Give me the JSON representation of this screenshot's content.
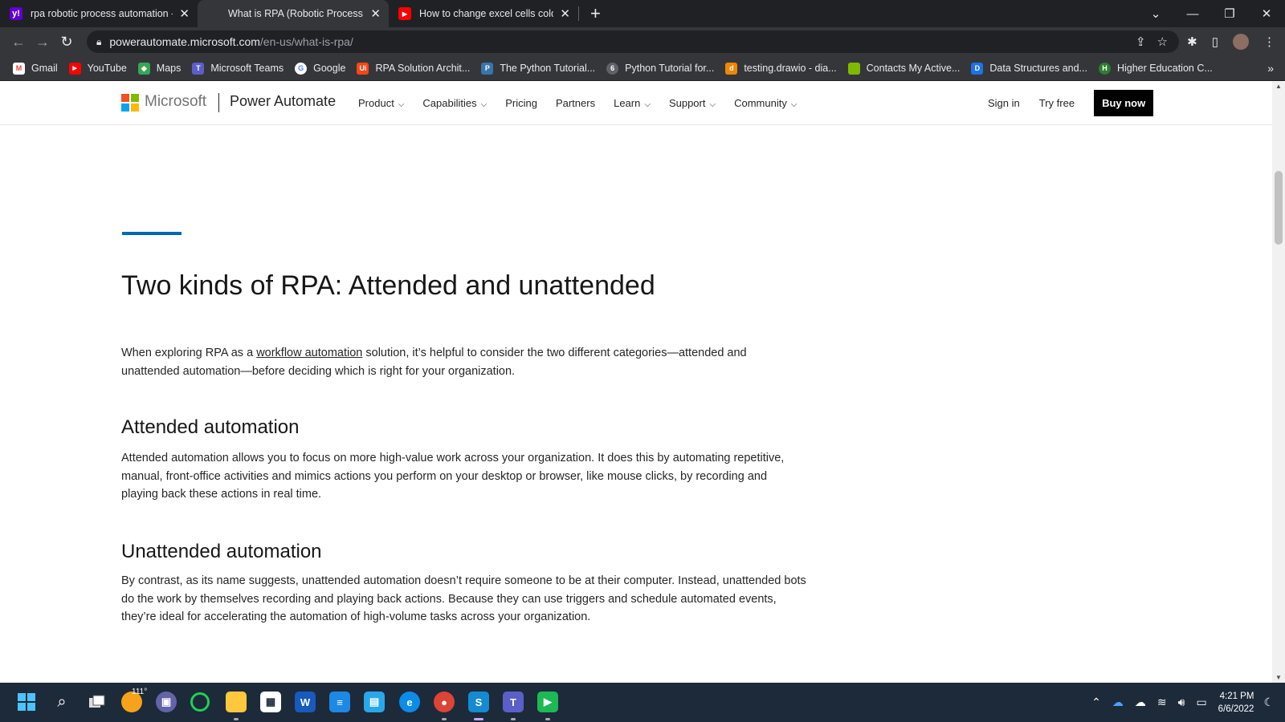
{
  "browser": {
    "tabs": [
      {
        "title": "rpa robotic process automation -",
        "favicon": "yahoo-favicon",
        "color": "#6001d2",
        "glyph": "y!"
      },
      {
        "title": "What is RPA (Robotic Process Au",
        "favicon": "microsoft-favicon",
        "color": "#f25022",
        "glyph": ""
      },
      {
        "title": "How to change excel cells color u",
        "favicon": "youtube-favicon",
        "color": "#ff0000",
        "glyph": "▶"
      }
    ],
    "url_host": "powerautomate.microsoft.com",
    "url_path": "/en-us/what-is-rpa/",
    "bookmarks": [
      {
        "label": "Gmail",
        "color": "#ea4335",
        "glyph": "M"
      },
      {
        "label": "YouTube",
        "color": "#ff0000",
        "glyph": "▶"
      },
      {
        "label": "Maps",
        "color": "#34a853",
        "glyph": "◆"
      },
      {
        "label": "Microsoft Teams",
        "color": "#5b5fc7",
        "glyph": "T"
      },
      {
        "label": "Google",
        "color": "#4285f4",
        "glyph": "G"
      },
      {
        "label": "RPA Solution Archit...",
        "color": "#fa4616",
        "glyph": "Ui"
      },
      {
        "label": "The Python Tutorial...",
        "color": "#3776ab",
        "glyph": "P"
      },
      {
        "label": "Python Tutorial for...",
        "color": "#5f6368",
        "glyph": "6"
      },
      {
        "label": "testing.drawio - dia...",
        "color": "#f08705",
        "glyph": "d"
      },
      {
        "label": "Contacts My Active...",
        "color": "#7fba00",
        "glyph": ""
      },
      {
        "label": "Data Structures and...",
        "color": "#1a73e8",
        "glyph": "D"
      },
      {
        "label": "Higher Education C...",
        "color": "#2e7d32",
        "glyph": "H"
      }
    ]
  },
  "site": {
    "brand": "Microsoft",
    "product": "Power Automate",
    "nav": [
      {
        "label": "Product",
        "dropdown": true
      },
      {
        "label": "Capabilities",
        "dropdown": true
      },
      {
        "label": "Pricing",
        "dropdown": false
      },
      {
        "label": "Partners",
        "dropdown": false
      },
      {
        "label": "Learn",
        "dropdown": true
      },
      {
        "label": "Support",
        "dropdown": true
      },
      {
        "label": "Community",
        "dropdown": true
      }
    ],
    "sign_in": "Sign in",
    "try_free": "Try free",
    "buy_now": "Buy now",
    "logo_colors": [
      "#f25022",
      "#7fba00",
      "#00a4ef",
      "#ffb900"
    ]
  },
  "article": {
    "heading": "Two kinds of RPA: Attended and unattended",
    "intro_before": "When exploring RPA as a ",
    "intro_link": "workflow automation",
    "intro_after": " solution, it’s helpful to consider the two different categories—attended and unattended automation—before deciding which is right for your organization.",
    "section1_title": "Attended automation",
    "section1_text": "Attended automation allows you to focus on more high-value work across your organization. It does this by automating repetitive, manual, front-office activities and mimics actions you perform on your desktop or browser, like mouse clicks, by recording and playing back these actions in real time.",
    "section2_title": "Unattended automation",
    "section2_text": "By contrast, as its name suggests, unattended automation doesn’t require someone to be at their computer. Instead, unattended bots do the work by themselves recording and playing back actions. Because they can use triggers and schedule automated events, they’re ideal for accelerating the automation of high-volume tasks across your organization."
  },
  "taskbar": {
    "weather_temp": "111°",
    "time": "4:21 PM",
    "date": "6/6/2022"
  }
}
